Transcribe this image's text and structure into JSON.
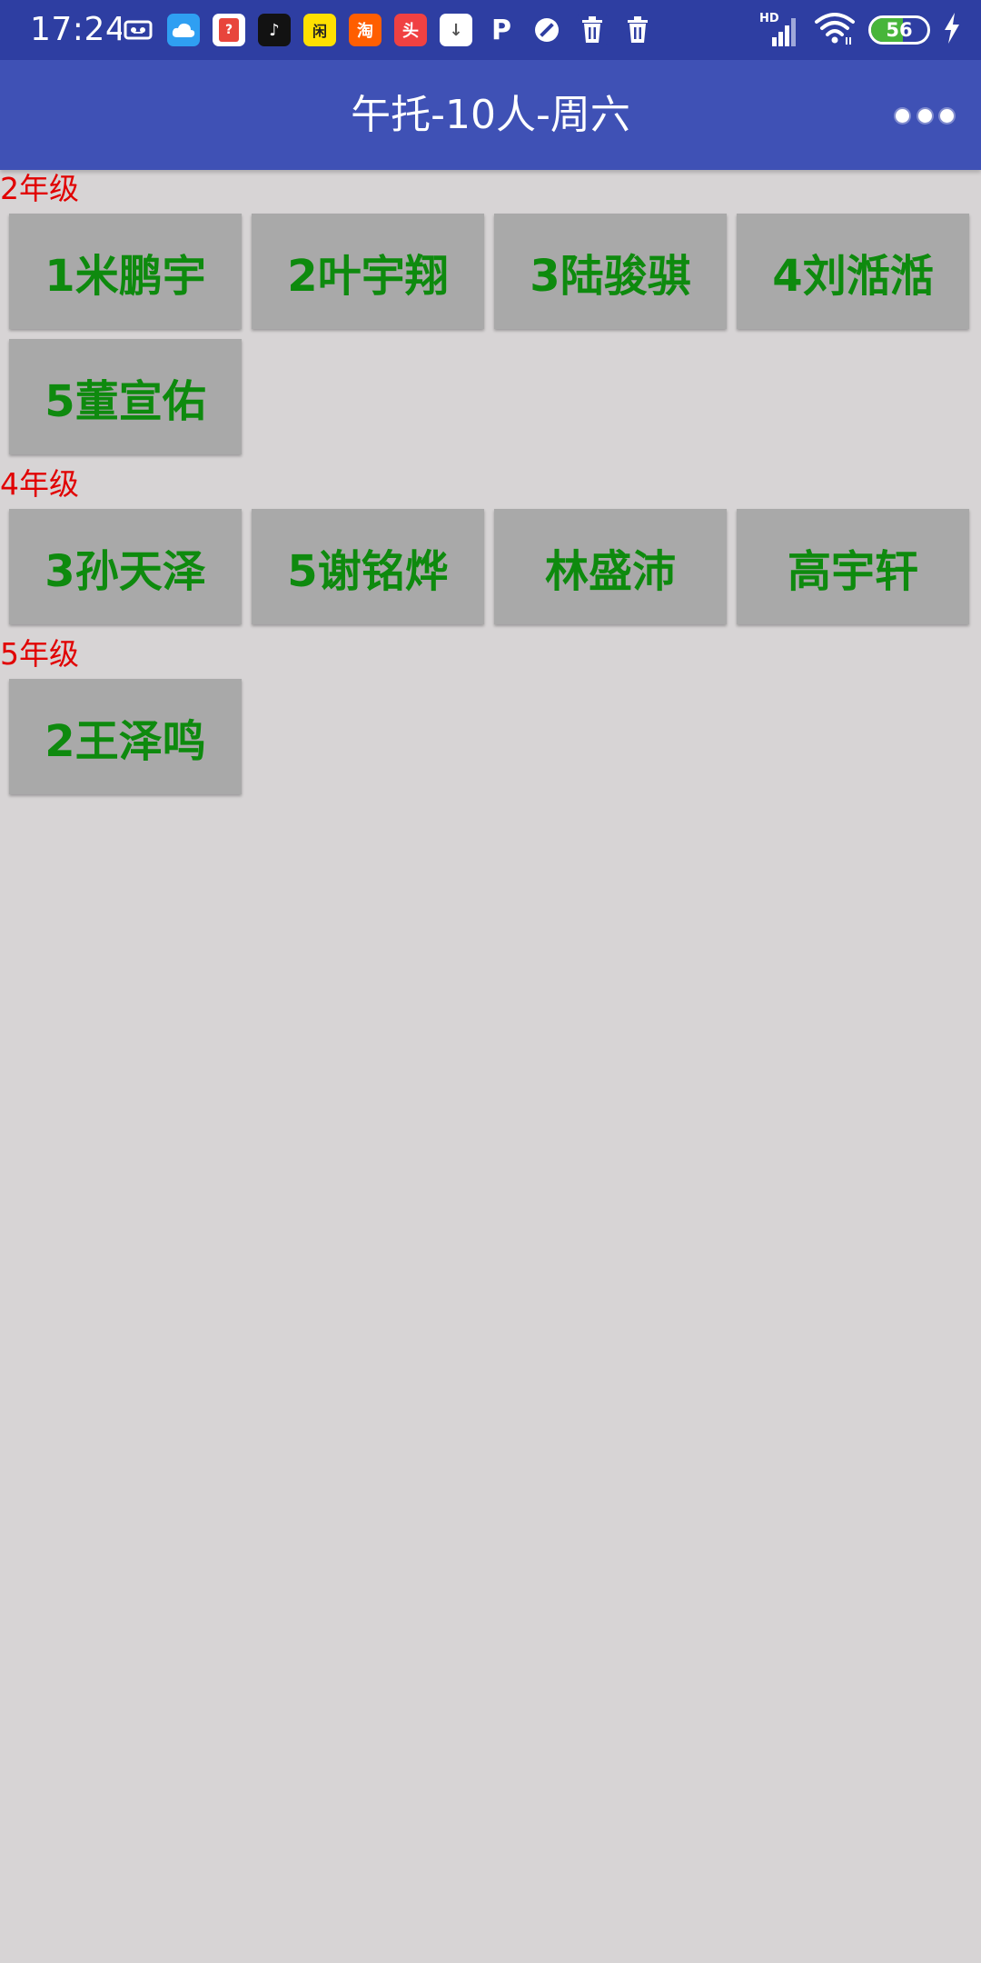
{
  "status_bar": {
    "time": "17:24",
    "notification_icons": [
      {
        "name": "voicemail-icon",
        "bg": "#2e3ea2",
        "glyph": ""
      },
      {
        "name": "cloud-app-icon",
        "bg": "#2f9ff2",
        "glyph": ""
      },
      {
        "name": "question-app-icon",
        "bg": "#ffffff",
        "glyph": "?"
      },
      {
        "name": "tiktok-icon",
        "bg": "#121212",
        "glyph": "♪"
      },
      {
        "name": "xianyu-app-icon",
        "bg": "#ffe000",
        "glyph": "闲"
      },
      {
        "name": "taobao-icon",
        "bg": "#ff5e00",
        "glyph": "淘"
      },
      {
        "name": "toutiao-icon",
        "bg": "#f04142",
        "glyph": "头"
      },
      {
        "name": "download-icon",
        "bg": "#ffffff",
        "glyph": "↓"
      },
      {
        "name": "p-app-icon",
        "bg": "#2e3ea2",
        "glyph": "P"
      },
      {
        "name": "block-icon",
        "bg": "#2e3ea2",
        "glyph": "⊘"
      },
      {
        "name": "trash-icon",
        "bg": "#2e3ea2",
        "glyph": ""
      },
      {
        "name": "trash-icon-2",
        "bg": "#2e3ea2",
        "glyph": ""
      }
    ],
    "hd_label": "HD",
    "battery_level": 56,
    "battery_text": "56",
    "battery_color": "#47b53a"
  },
  "app_bar": {
    "title": "午托-10人-周六"
  },
  "grades": [
    {
      "label": "2年级",
      "students": [
        "1米鹏宇",
        "2叶宇翔",
        "3陆骏骐",
        "4刘湉湉",
        "5董宣佑"
      ]
    },
    {
      "label": "4年级",
      "students": [
        "3孙天泽",
        "5谢铭烨",
        "林盛沛",
        "高宇轩"
      ]
    },
    {
      "label": "5年级",
      "students": [
        "2王泽鸣"
      ]
    }
  ],
  "colors": {
    "status_bar": "#2e3ea2",
    "app_bar": "#3f51b5",
    "background": "#d7d4d5",
    "grade_label": "#e10000",
    "student_text": "#0e8a0e",
    "student_button": "#a9a9a9"
  }
}
